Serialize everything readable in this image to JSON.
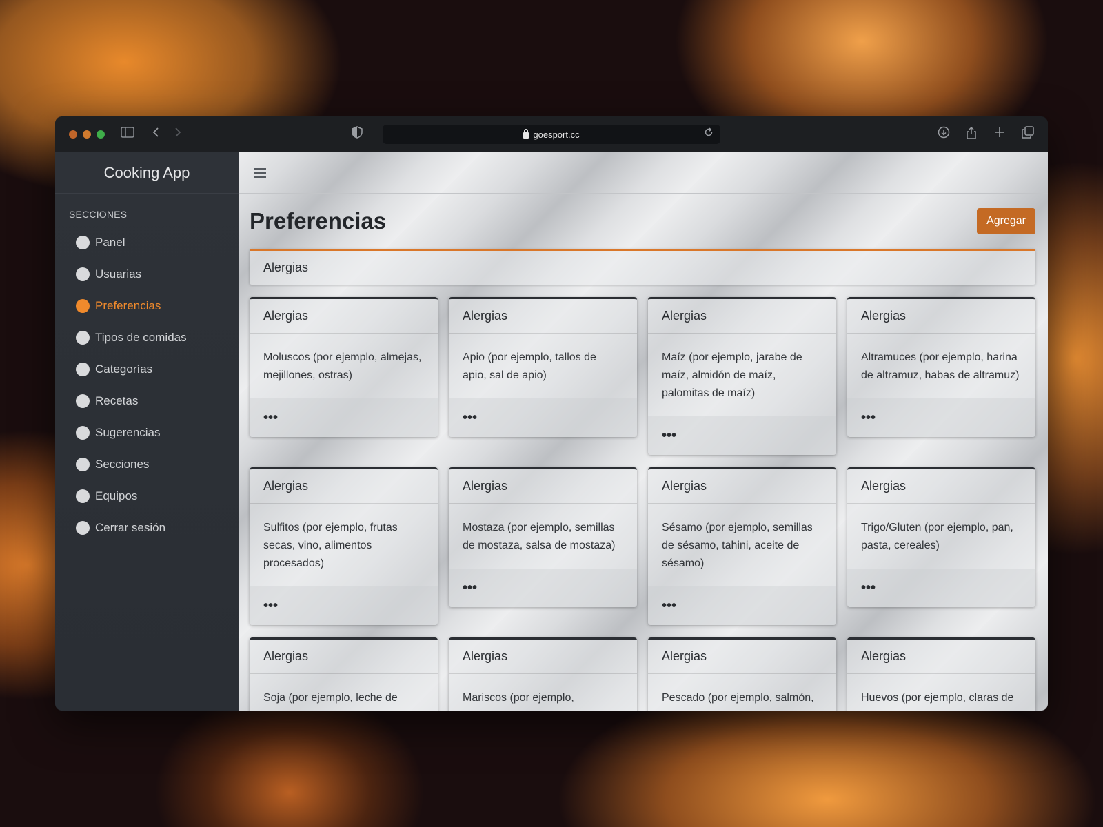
{
  "browser": {
    "url": "goesport.cc",
    "traffic_colors": [
      "#c0652a",
      "#d07a2e",
      "#3fae4a"
    ]
  },
  "sidebar": {
    "brand": "Cooking App",
    "section_title": "SECCIONES",
    "items": [
      {
        "label": "Panel"
      },
      {
        "label": "Usuarias"
      },
      {
        "label": "Preferencias"
      },
      {
        "label": "Tipos de comidas"
      },
      {
        "label": "Categorías"
      },
      {
        "label": "Recetas"
      },
      {
        "label": "Sugerencias"
      },
      {
        "label": "Secciones"
      },
      {
        "label": "Equipos"
      },
      {
        "label": "Cerrar sesión"
      }
    ],
    "active_item": "Preferencias",
    "accent": "#f08a2c"
  },
  "page": {
    "title": "Preferencias",
    "add_label": "Agregar",
    "group_label": "Alergias"
  },
  "cards": [
    {
      "title": "Alergias",
      "text": "Moluscos (por ejemplo, almejas, mejillones, ostras)",
      "menu": "•••"
    },
    {
      "title": "Alergias",
      "text": "Apio (por ejemplo, tallos de apio, sal de apio)",
      "menu": "•••"
    },
    {
      "title": "Alergias",
      "text": "Maíz (por ejemplo, jarabe de maíz, almidón de maíz, palomitas de maíz)",
      "menu": "•••"
    },
    {
      "title": "Alergias",
      "text": "Altramuces (por ejemplo, harina de altramuz, habas de altramuz)",
      "menu": "•••"
    },
    {
      "title": "Alergias",
      "text": "Sulfitos (por ejemplo, frutas secas, vino, alimentos procesados)",
      "menu": "•••"
    },
    {
      "title": "Alergias",
      "text": "Mostaza (por ejemplo, semillas de mostaza, salsa de mostaza)",
      "menu": "•••"
    },
    {
      "title": "Alergias",
      "text": "Sésamo (por ejemplo, semillas de sésamo, tahini, aceite de sésamo)",
      "menu": "•••"
    },
    {
      "title": "Alergias",
      "text": "Trigo/Gluten (por ejemplo, pan, pasta, cereales)",
      "menu": "•••"
    },
    {
      "title": "Alergias",
      "text": "Soja (por ejemplo, leche de soja, tofu, salsa de soja)",
      "menu": "•••"
    },
    {
      "title": "Alergias",
      "text": "Mariscos (por ejemplo, camarones, cangrejo, langosta)",
      "menu": "•••"
    },
    {
      "title": "Alergias",
      "text": "Pescado (por ejemplo, salmón, atún, bacalao)",
      "menu": "•••"
    },
    {
      "title": "Alergias",
      "text": "Huevos (por ejemplo, claras de huevo, yemas de huevo)",
      "menu": "•••"
    }
  ]
}
